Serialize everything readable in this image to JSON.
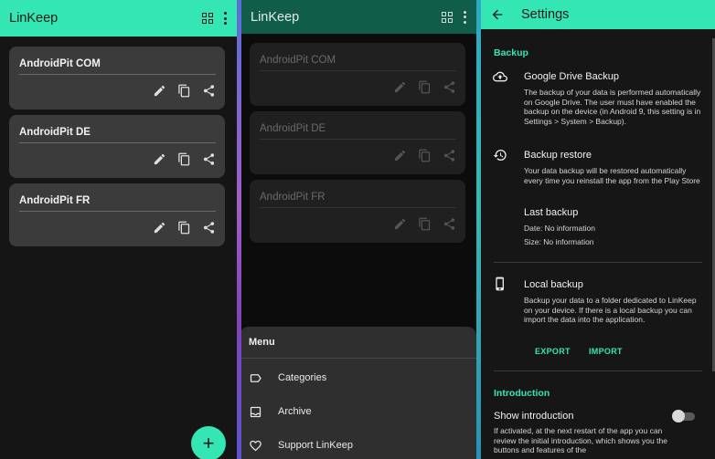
{
  "app": {
    "title": "LinKeep"
  },
  "cards": [
    {
      "name": "AndroidPit COM"
    },
    {
      "name": "AndroidPit DE"
    },
    {
      "name": "AndroidPit FR"
    }
  ],
  "fab": {
    "label": "+"
  },
  "menu": {
    "title": "Menu",
    "items": [
      {
        "label": "Categories",
        "icon": "label-icon"
      },
      {
        "label": "Archive",
        "icon": "inbox-icon"
      },
      {
        "label": "Support LinKeep",
        "icon": "heart-icon"
      }
    ]
  },
  "settings": {
    "title": "Settings",
    "backup_header": "Backup",
    "drive_title": "Google Drive Backup",
    "drive_text": "The backup of your data is performed automatically on Google Drive. The user must have enabled the backup on the device (in Android 9, this setting is in Settings > System > Backup).",
    "restore_title": "Backup restore",
    "restore_text": "Your data backup will be restored automatically every time you reinstall the app from the Play Store",
    "last_title": "Last backup",
    "last_date": "Date: No information",
    "last_size": "Size: No information",
    "local_title": "Local backup",
    "local_text": "Backup your data to a folder dedicated to LinKeep on your device. If there is a local backup you can import the data into the application.",
    "export": "EXPORT",
    "import": "IMPORT",
    "intro_header": "Introduction",
    "intro_title": "Show introduction",
    "intro_text": "If activated, at the next restart of the app you can review the initial introduction, which shows you the buttons and features of the",
    "intro_toggle": false
  },
  "colors": {
    "accent": "#34e6b4",
    "card": "#3b3b3b",
    "background": "#151515"
  }
}
